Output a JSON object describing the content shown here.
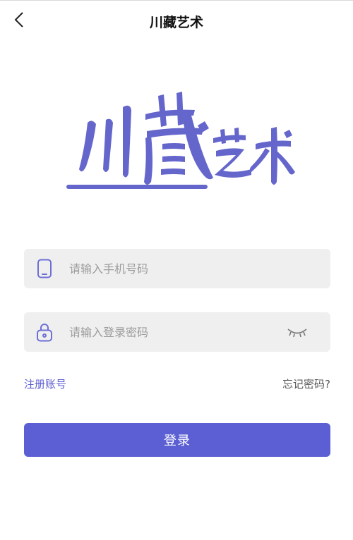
{
  "header": {
    "title": "川藏艺术",
    "back_icon": "chevron-left-icon"
  },
  "logo": {
    "text": "川藏艺术",
    "color": "#6566cc"
  },
  "form": {
    "phone": {
      "placeholder": "请输入手机号码",
      "value": "",
      "icon": "phone-icon"
    },
    "password": {
      "placeholder": "请输入登录密码",
      "value": "",
      "icon": "lock-icon",
      "toggle_icon": "eye-closed-icon"
    }
  },
  "links": {
    "register": "注册账号",
    "forgot": "忘记密码?"
  },
  "login_button": {
    "label": "登录"
  },
  "colors": {
    "accent": "#5c5fd3",
    "field_bg": "#efefef",
    "placeholder": "#9c9c9c"
  }
}
